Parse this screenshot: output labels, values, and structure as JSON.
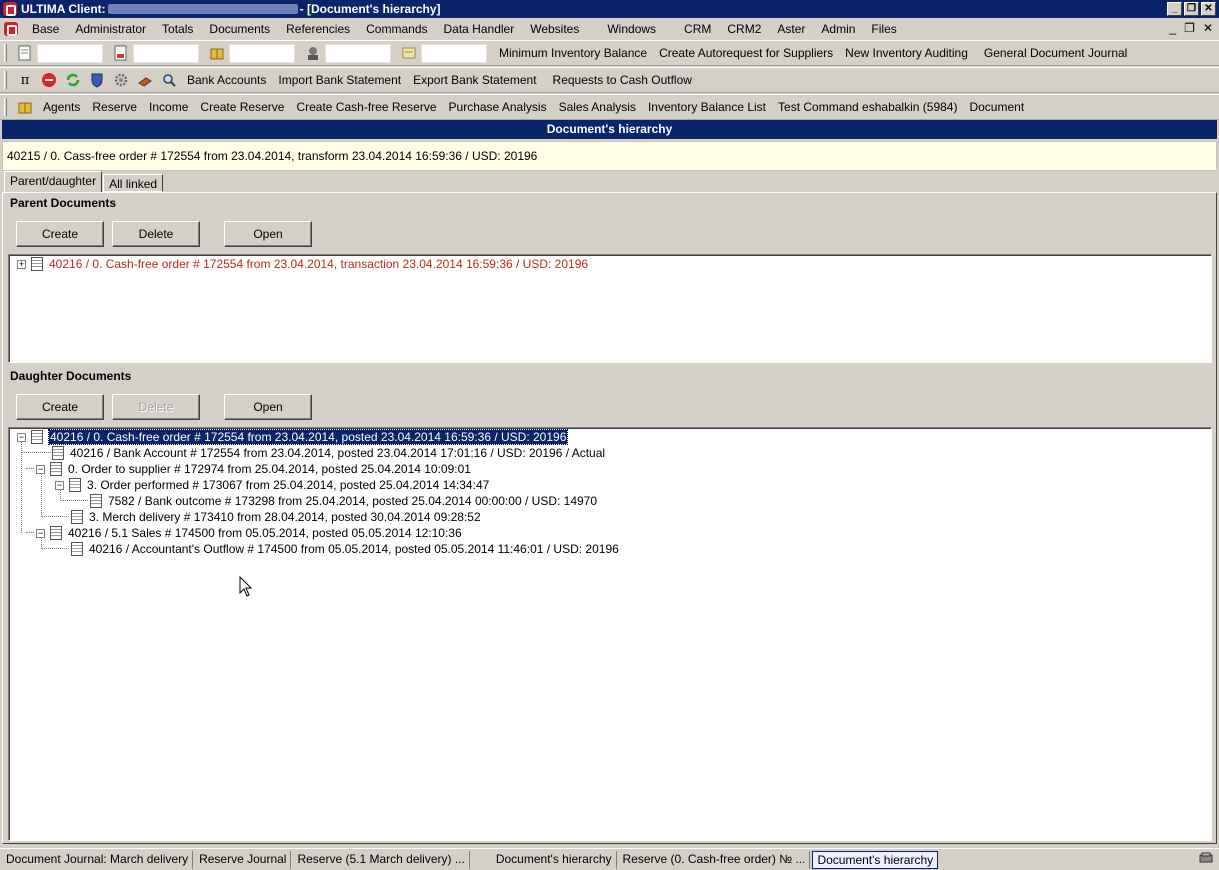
{
  "window": {
    "title_prefix": "ULTIMA Client:",
    "title_suffix": "- [Document's hierarchy]",
    "btn_min": "_",
    "btn_restore": "❐",
    "btn_close": "✕"
  },
  "menu": {
    "items": [
      "Base",
      "Administrator",
      "Totals",
      "Documents",
      "Referencies",
      "Commands",
      "Data Handler",
      "Websites",
      "Windows",
      "CRM",
      "CRM2",
      "Aster",
      "Admin",
      "Files"
    ],
    "mdi_min": "_",
    "mdi_restore": "❐",
    "mdi_close": "✕"
  },
  "toolbar1": {
    "links": [
      "Minimum Inventory Balance",
      "Create Autorequest for Suppliers",
      "New Inventory Auditing",
      "General Document Journal"
    ]
  },
  "toolbar2": {
    "links": [
      "Bank Accounts",
      "Import Bank Statement",
      "Export Bank Statement",
      "Requests to Cash Outflow"
    ],
    "pi_glyph": "π"
  },
  "toolbar3": {
    "links": [
      "Agents",
      "Reserve",
      "Income",
      "Create Reserve",
      "Create Cash-free Reserve",
      "Purchase Analysis",
      "Sales Analysis",
      "Inventory Balance List",
      "Test Command eshabalkin (5984)",
      "Document"
    ]
  },
  "panel": {
    "title": "Document's hierarchy",
    "info": "40215 / 0. Cass-free order # 172554 from 23.04.2014, transform 23.04.2014 16:59:36 / USD: 20196"
  },
  "tabs": {
    "parent_daughter": "Parent/daughter",
    "all_linked": "All linked"
  },
  "parent": {
    "title": "Parent Documents",
    "create": "Create",
    "delete": "Delete",
    "open": "Open",
    "nodes": [
      "40216 / 0. Cash-free order # 172554 from 23.04.2014, transaction 23.04.2014 16:59:36 / USD: 20196"
    ]
  },
  "daughter": {
    "title": "Daughter Documents",
    "create": "Create",
    "delete": "Delete",
    "open": "Open",
    "nodes": [
      "40216 / 0. Cash-free order # 172554 from 23.04.2014, posted 23.04.2014 16:59:36 / USD: 20196",
      "40216 / Bank Account # 172554 from 23.04.2014, posted 23.04.2014 17:01:16 / USD: 20196 / Actual",
      "0. Order to supplier # 172974 from 25.04.2014, posted 25.04.2014 10:09:01",
      "3. Order performed # 173067 from 25.04.2014, posted 25.04.2014 14:34:47",
      "7582 / Bank outcome # 173298 from 25.04.2014, posted 25.04.2014 00:00:00 / USD: 14970",
      "3. Merch delivery # 173410 from 28.04.2014, posted 30.04.2014 09:28:52",
      "40216 / 5.1 Sales # 174500 from 05.05.2014, posted 05.05.2014 12:10:36",
      "40216 / Accountant's Outflow # 174500 from 05.05.2014, posted 05.05.2014 11:46:01 / USD: 20196"
    ]
  },
  "statusbar": {
    "items": [
      "Document Journal: March delivery",
      "Reserve Journal",
      "Reserve (5.1 March delivery) ...",
      "Document's hierarchy",
      "Reserve (0. Cash-free order) № ...",
      "Document's hierarchy"
    ]
  }
}
